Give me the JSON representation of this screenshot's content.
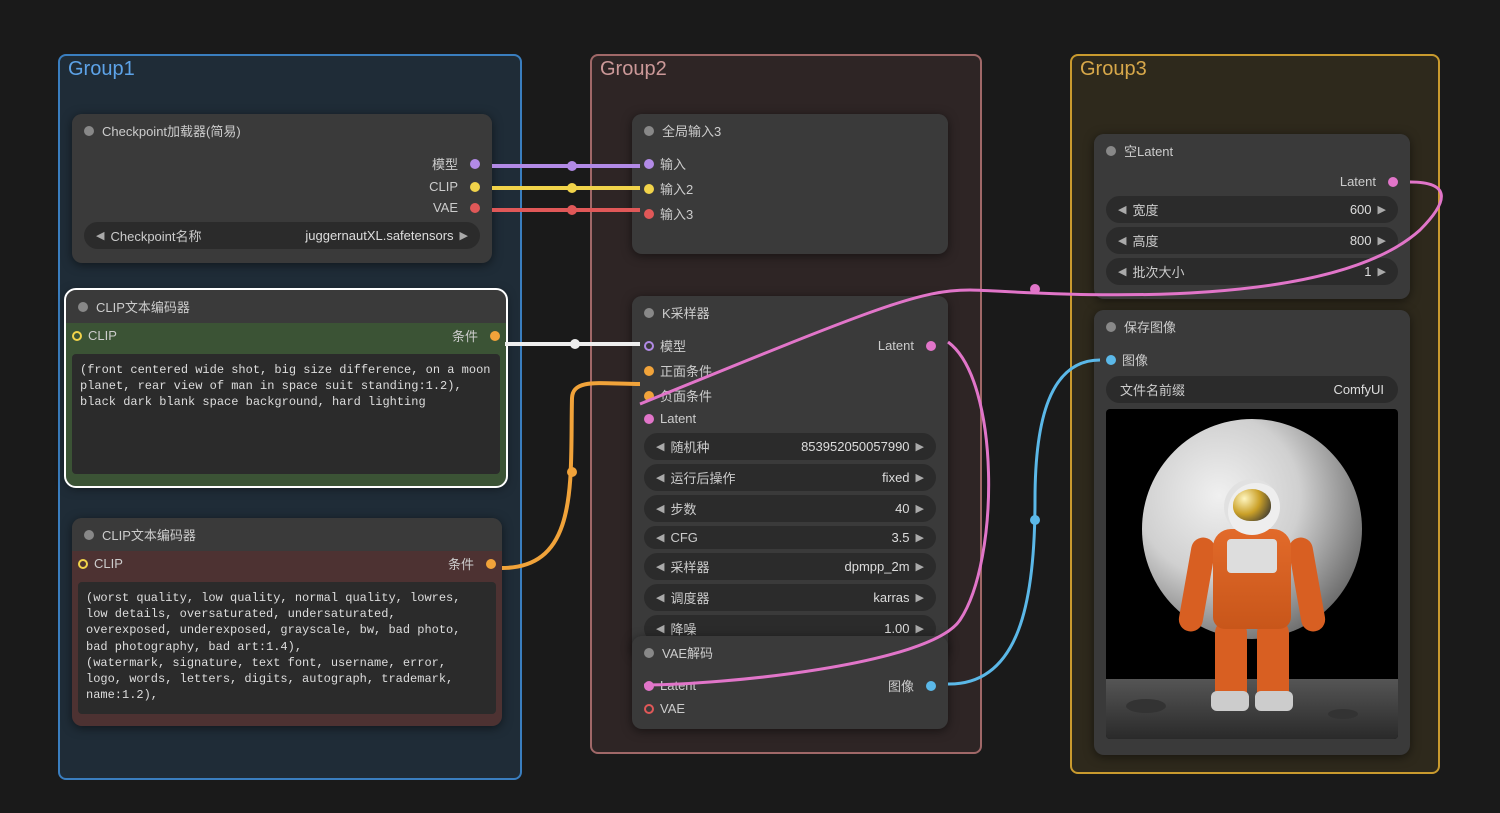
{
  "groups": {
    "g1": "Group1",
    "g2": "Group2",
    "g3": "Group3"
  },
  "checkpoint": {
    "title": "Checkpoint加载器(简易)",
    "out_model": "模型",
    "out_clip": "CLIP",
    "out_vae": "VAE",
    "widget_label": "Checkpoint名称",
    "widget_value": "juggernautXL.safetensors"
  },
  "clip_pos": {
    "title": "CLIP文本编码器",
    "in_clip": "CLIP",
    "out_cond": "条件",
    "text": "(front centered wide shot, big size difference, on a moon planet, rear view of man in space suit standing:1.2),\nblack dark blank space background, hard lighting"
  },
  "clip_neg": {
    "title": "CLIP文本编码器",
    "in_clip": "CLIP",
    "out_cond": "条件",
    "text": "(worst quality, low quality, normal quality, lowres, low details, oversaturated, undersaturated, overexposed, underexposed, grayscale, bw, bad photo, bad photography, bad art:1.4),\n(watermark, signature, text font, username, error, logo, words, letters, digits, autograph, trademark, name:1.2),"
  },
  "reroute": {
    "title": "全局输入3",
    "in1": "输入",
    "in2": "输入2",
    "in3": "输入3"
  },
  "ksampler": {
    "title": "K采样器",
    "in_model": "模型",
    "in_pos": "正面条件",
    "in_neg": "负面条件",
    "in_latent": "Latent",
    "out_latent": "Latent",
    "w_seed_label": "随机种",
    "w_seed_value": "853952050057990",
    "w_ctrl_label": "运行后操作",
    "w_ctrl_value": "fixed",
    "w_steps_label": "步数",
    "w_steps_value": "40",
    "w_cfg_label": "CFG",
    "w_cfg_value": "3.5",
    "w_sampler_label": "采样器",
    "w_sampler_value": "dpmpp_2m",
    "w_sched_label": "调度器",
    "w_sched_value": "karras",
    "w_denoise_label": "降噪",
    "w_denoise_value": "1.00"
  },
  "vae": {
    "title": "VAE解码",
    "in_latent": "Latent",
    "in_vae": "VAE",
    "out_image": "图像"
  },
  "empty_latent": {
    "title": "空Latent",
    "out_latent": "Latent",
    "w_width_label": "宽度",
    "w_width_value": "600",
    "w_height_label": "高度",
    "w_height_value": "800",
    "w_batch_label": "批次大小",
    "w_batch_value": "1"
  },
  "save": {
    "title": "保存图像",
    "in_image": "图像",
    "w_prefix_label": "文件名前缀",
    "w_prefix_value": "ComfyUI"
  },
  "colors": {
    "model": "#b28ae6",
    "clip": "#f1d34a",
    "vae": "#e05858",
    "cond": "#f1a33a",
    "latent": "#e175c9",
    "image": "#5bb8e8",
    "route": "#ccc"
  }
}
